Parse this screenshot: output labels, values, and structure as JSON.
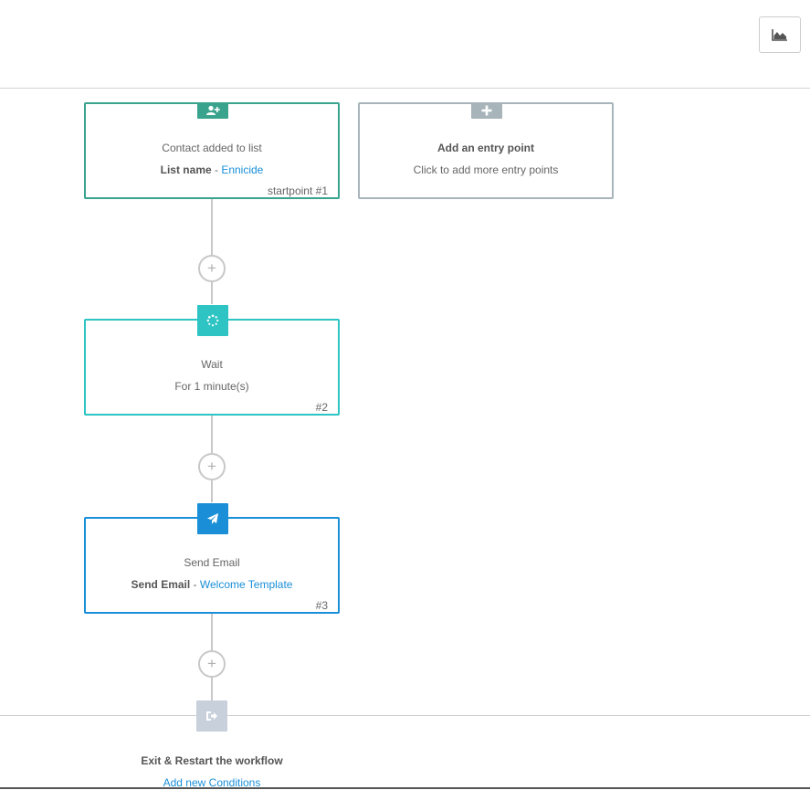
{
  "toolbar": {
    "stats_icon": "area-chart-icon"
  },
  "nodes": {
    "start": {
      "icon": "add-user-icon",
      "title": "Contact added to list",
      "detail_label": "List name",
      "detail_sep": " - ",
      "detail_value": "Ennicide",
      "tag": "startpoint #1",
      "color": "#3aa38d"
    },
    "entry": {
      "icon": "plus-icon",
      "title": "Add an entry point",
      "subtitle": "Click to add more entry points",
      "color": "#a7b4ba"
    },
    "wait": {
      "icon": "spinner-icon",
      "title": "Wait",
      "detail": "For 1 minute(s)",
      "tag": "#2",
      "color": "#2ec4c4"
    },
    "email": {
      "icon": "paper-plane-icon",
      "title": "Send Email",
      "detail_label": "Send Email",
      "detail_sep": " - ",
      "detail_value": "Welcome Template",
      "tag": "#3",
      "color": "#1a8fd8"
    }
  },
  "add_step": {
    "symbol": "+"
  },
  "exit": {
    "icon": "sign-out-icon",
    "title": "Exit & Restart the workflow",
    "link": "Add new Conditions",
    "color": "#c7d0db"
  }
}
